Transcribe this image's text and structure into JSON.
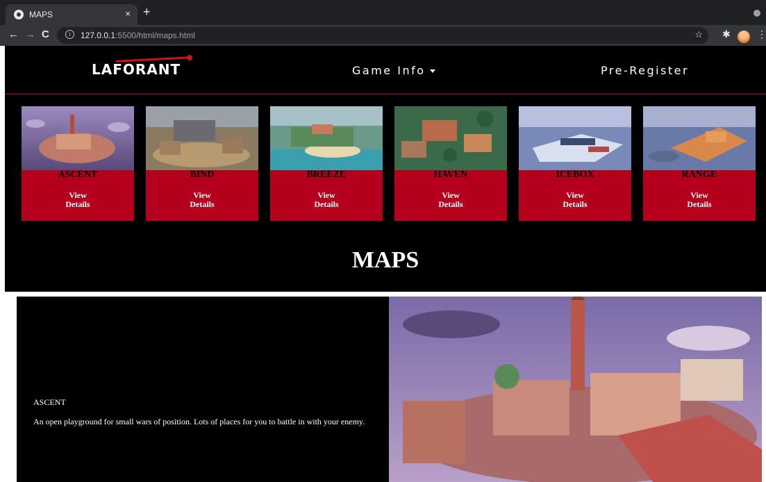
{
  "browser": {
    "tab_title": "MAPS",
    "tab_close": "×",
    "new_tab": "+",
    "url_host": "127.0.0.1",
    "url_rest": ":5500/html/maps.html",
    "icons": [
      "back-icon",
      "forward-icon",
      "reload-icon",
      "info-icon",
      "star-icon",
      "extensions-icon",
      "menu-icon"
    ]
  },
  "site": {
    "logo": "LAFORANT",
    "nav": {
      "game_info": "Game Info",
      "pre_register": "Pre-Register"
    },
    "accent_color": "#b4001c",
    "maps": [
      {
        "name": "ASCENT",
        "action": "View Details"
      },
      {
        "name": "BIND",
        "action": "View Details"
      },
      {
        "name": "BREEZE",
        "action": "View Details"
      },
      {
        "name": "HAVEN",
        "action": "View Details"
      },
      {
        "name": "ICEBOX",
        "action": "View Details"
      },
      {
        "name": "RANGE",
        "action": "View Details"
      }
    ],
    "heading": "MAPS",
    "selected": {
      "name": "ASCENT",
      "description": "An open playground for small wars of position. Lots of places for you to battle in with your enemy."
    }
  }
}
